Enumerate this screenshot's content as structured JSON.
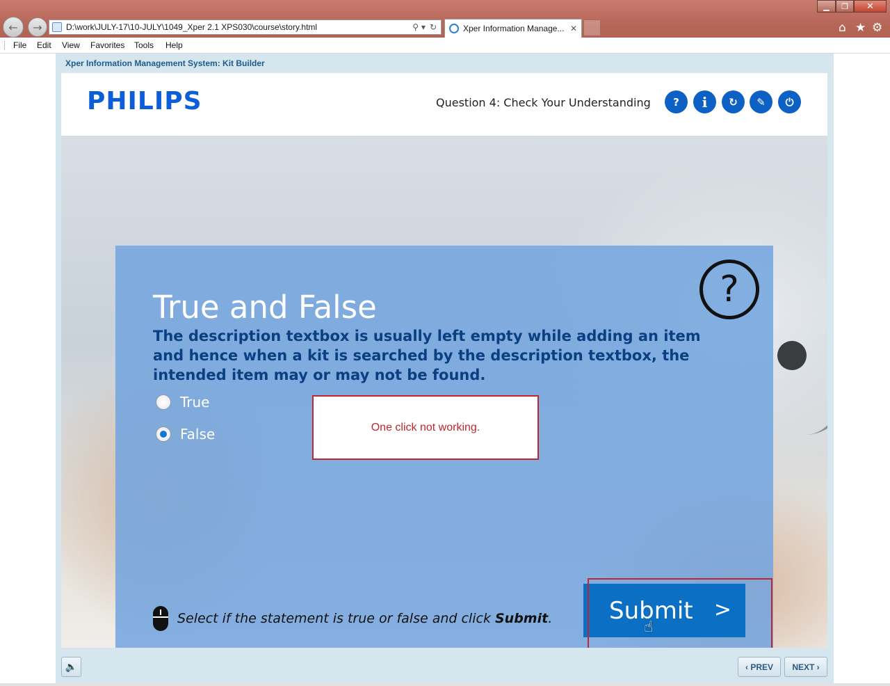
{
  "browser": {
    "address_url": "D:\\work\\JULY-17\\10-JULY\\1049_Xper 2.1 XPS030\\course\\story.html",
    "search_glyph": "⚲ ▾",
    "refresh_glyph": "↻",
    "tab_title": "Xper Information Manage...",
    "tab_close": "✕",
    "back_glyph": "←",
    "forward_glyph": "→",
    "window_min": "▁",
    "window_max": "❐",
    "window_close": "✕",
    "home_glyph": "⌂",
    "favorites_glyph": "★",
    "settings_glyph": "⚙"
  },
  "menu": {
    "file": "File",
    "edit": "Edit",
    "view": "View",
    "favorites": "Favorites",
    "tools": "Tools",
    "help": "Help"
  },
  "course": {
    "frame_title": "Xper Information Management System: Kit Builder",
    "logo": "PHILIPS",
    "question_title": "Question 4: Check Your Understanding",
    "header_buttons": {
      "help": "?",
      "info": "i",
      "replay": "↻",
      "resources": "✎",
      "exit": "⏻"
    }
  },
  "quiz": {
    "heading": "True and False",
    "statement": "The description textbox is usually left empty while adding an item and hence when a kit is searched by the description textbox, the intended item may or may not be found.",
    "help_mark": "?",
    "options": [
      {
        "label": "True",
        "selected": false
      },
      {
        "label": "False",
        "selected": true
      }
    ],
    "annotation_note": "One click not working.",
    "instruction_prefix": "Select if the statement is true or false and click ",
    "instruction_bold": "Submit",
    "instruction_suffix": ".",
    "submit_label": "Submit",
    "submit_arrow": ">"
  },
  "footer": {
    "volume_glyph": "🔈",
    "prev_label": "‹ PREV",
    "next_label": "NEXT ›"
  },
  "colors": {
    "brand_blue": "#0b5ed7",
    "panel_blue": "#72a4de",
    "submit_blue": "#0b6fc3",
    "annotation_red": "#c0262d"
  }
}
